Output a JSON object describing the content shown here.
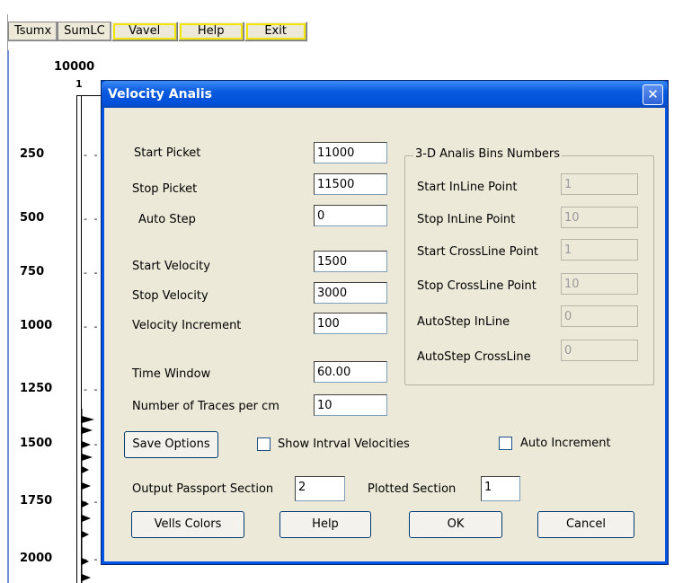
{
  "toolbar": {
    "buttons": [
      "Tsumx",
      "SumLC",
      "Vavel",
      "Help",
      "Exit"
    ]
  },
  "plot": {
    "top_value": "10000",
    "top_index": "1",
    "y_labels": [
      "250",
      "500",
      "750",
      "1000",
      "1250",
      "1500",
      "1750",
      "2000"
    ],
    "tick_text": "- - -"
  },
  "dialog": {
    "title": "Velocity Analis",
    "close_glyph": "✕",
    "fields": {
      "start_picket": {
        "label": "Start Picket",
        "value": "11000"
      },
      "stop_picket": {
        "label": "Stop Picket",
        "value": "11500"
      },
      "auto_step": {
        "label": "Auto Step",
        "value": "0"
      },
      "start_velocity": {
        "label": "Start Velocity",
        "value": "1500"
      },
      "stop_velocity": {
        "label": "Stop Velocity",
        "value": "3000"
      },
      "velocity_increment": {
        "label": "Velocity Increment",
        "value": "100"
      },
      "time_window": {
        "label": "Time Window",
        "value": "60.00"
      },
      "traces_per_cm": {
        "label": "Number of Traces per cm",
        "value": "10"
      }
    },
    "bins": {
      "legend": "3-D Analis Bins Numbers",
      "start_inline": {
        "label": "Start InLine Point",
        "value": "1"
      },
      "stop_inline": {
        "label": "Stop InLine Point",
        "value": "10"
      },
      "start_crossline": {
        "label": "Start CrossLine Point",
        "value": "1"
      },
      "stop_crossline": {
        "label": "Stop CrossLine Point",
        "value": "10"
      },
      "autostep_inline": {
        "label": "AutoStep InLine",
        "value": "0"
      },
      "autostep_crossline": {
        "label": "AutoStep CrossLine",
        "value": "0"
      }
    },
    "save_options": "Save Options",
    "show_intrval": "Show Intrval Velocities",
    "auto_increment": "Auto Increment",
    "output_passport": {
      "label": "Output Passport Section",
      "value": "2"
    },
    "plotted_section": {
      "label": "Plotted Section",
      "value": "1"
    },
    "buttons": {
      "vells_colors": "Vells Colors",
      "help": "Help",
      "ok": "OK",
      "cancel": "Cancel"
    }
  }
}
